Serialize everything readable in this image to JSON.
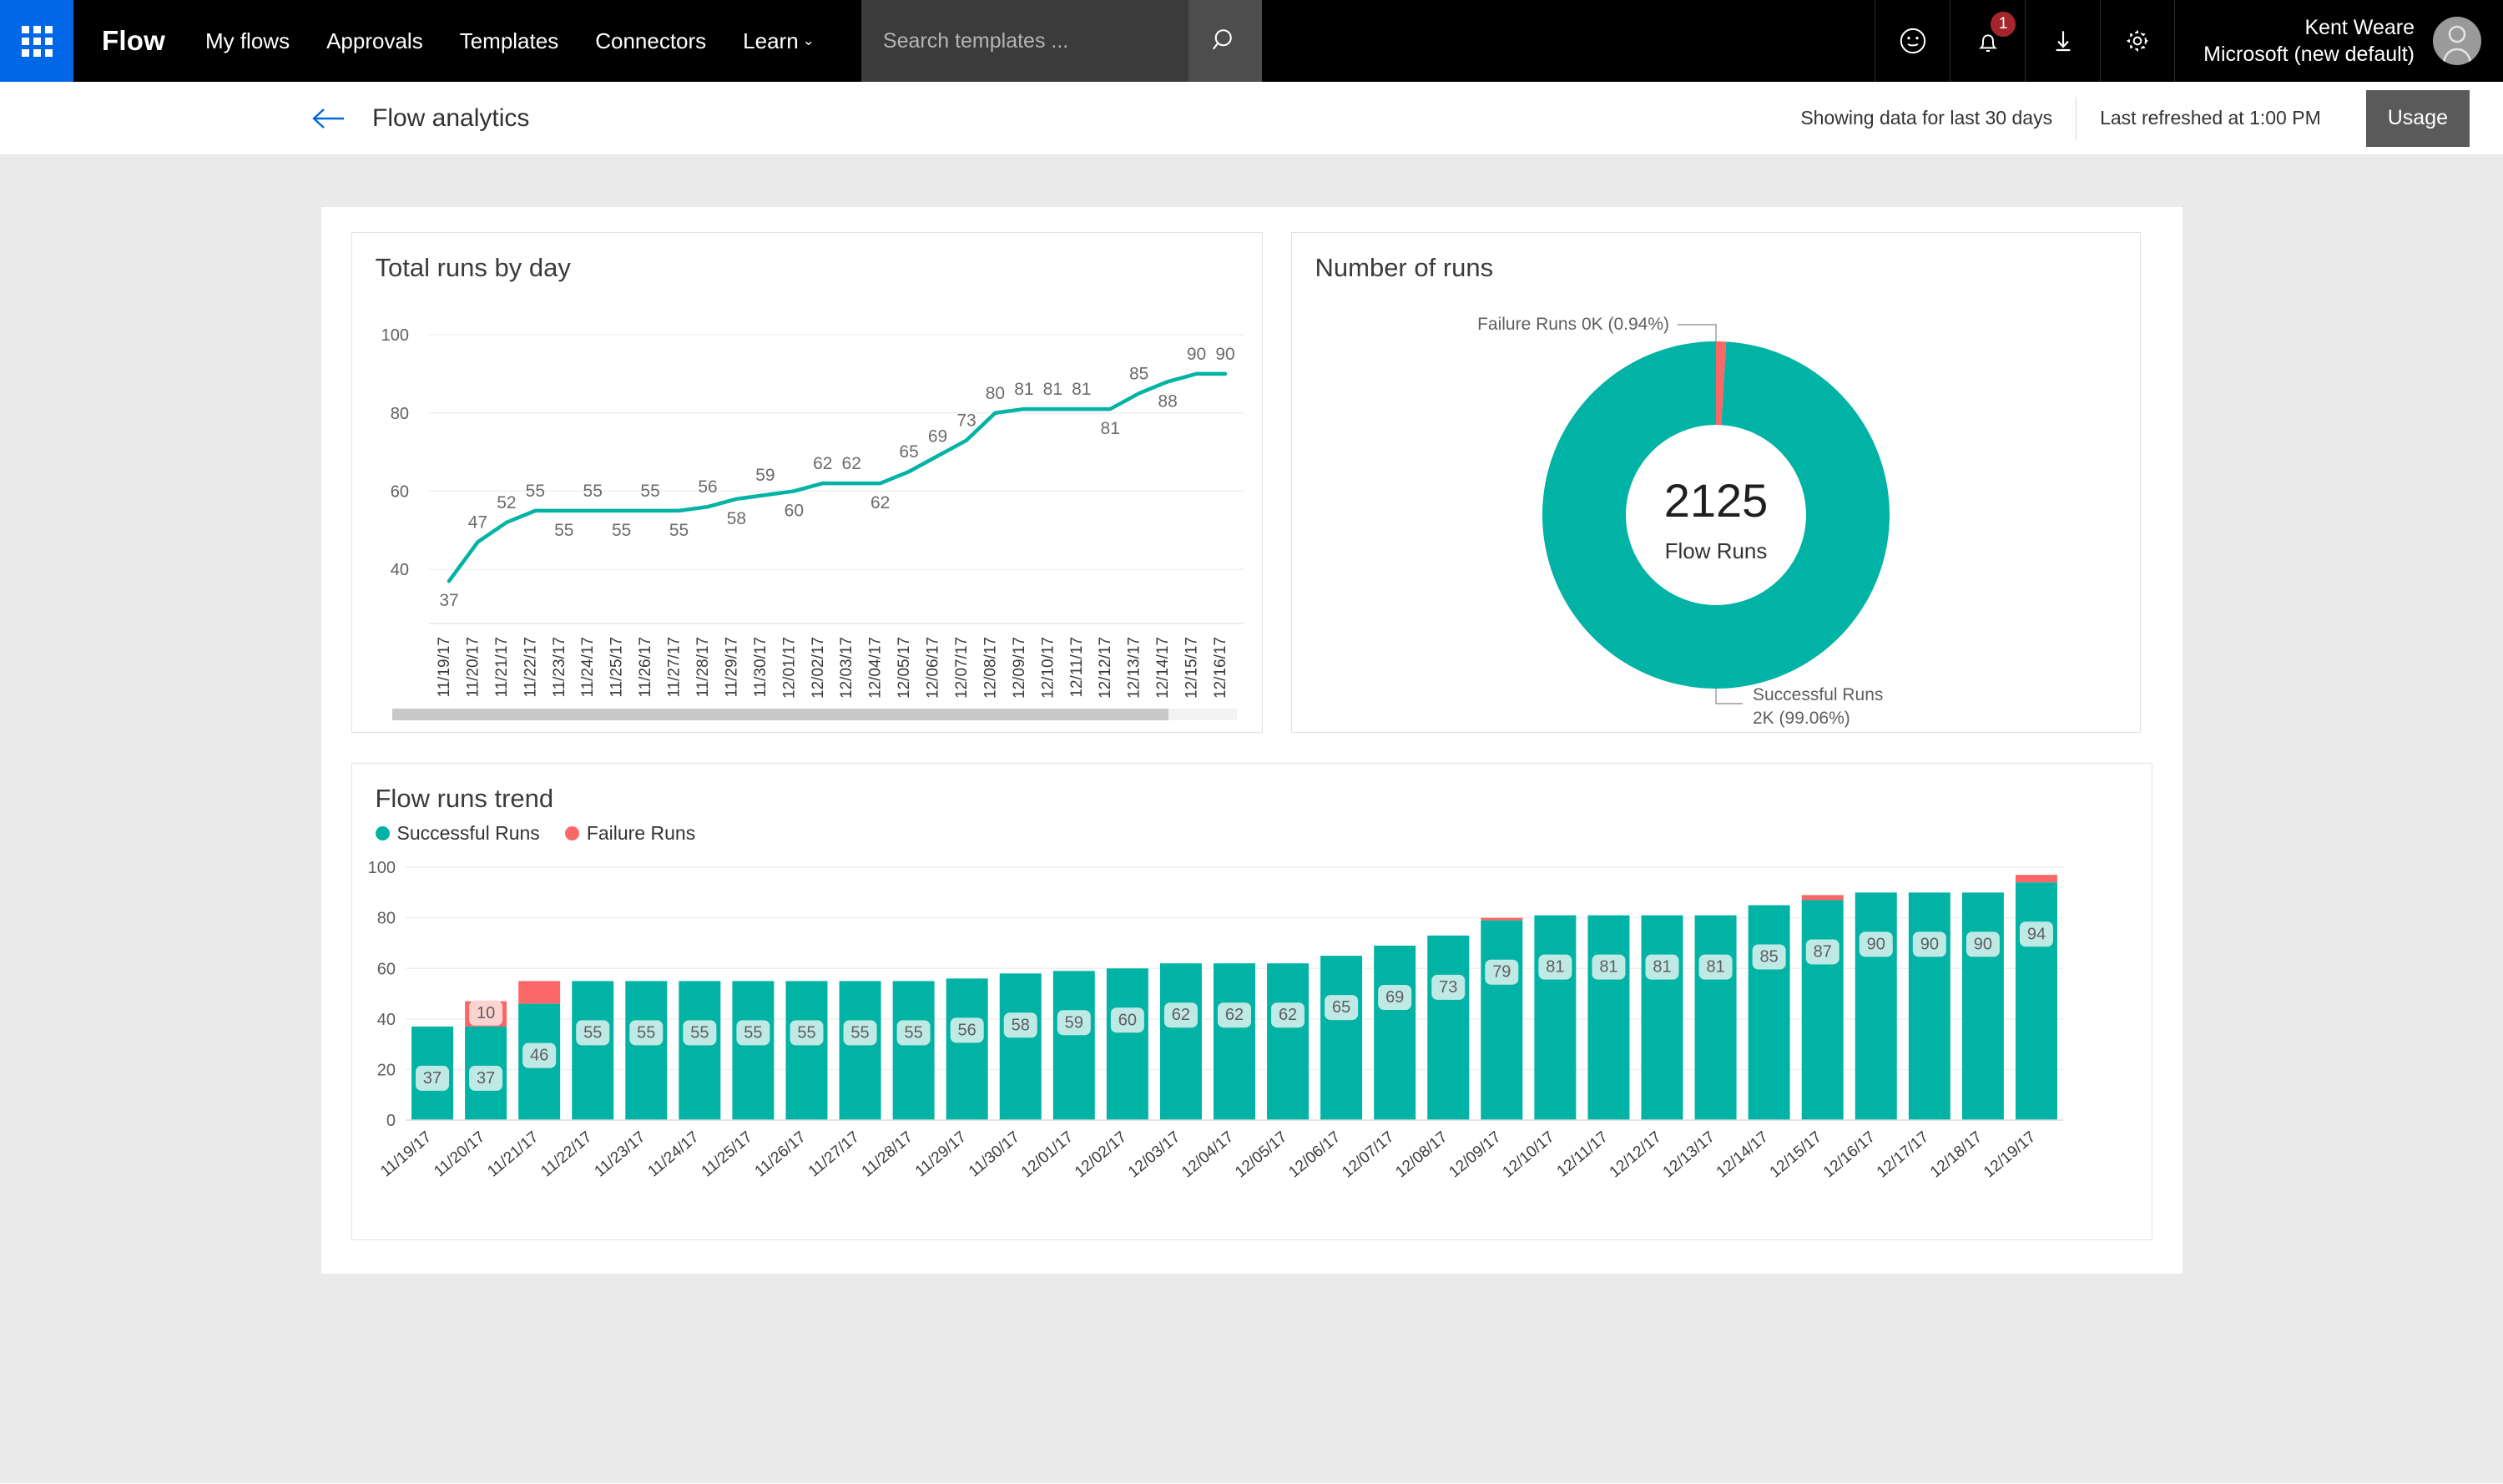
{
  "topnav": {
    "waffle_icon": "waffle-grid-icon",
    "brand": "Flow",
    "links": [
      {
        "label": "My flows",
        "caret": ""
      },
      {
        "label": "Approvals",
        "caret": ""
      },
      {
        "label": "Templates",
        "caret": ""
      },
      {
        "label": "Connectors",
        "caret": ""
      },
      {
        "label": "Learn",
        "caret": "⌄"
      }
    ],
    "search": {
      "value": "",
      "placeholder": "Search templates ...",
      "icon": "search-icon"
    },
    "icons": [
      {
        "name": "smiley-feedback-icon"
      },
      {
        "name": "notification-bell-icon",
        "badge": "1"
      },
      {
        "name": "download-icon"
      },
      {
        "name": "gear-settings-icon"
      }
    ],
    "user": {
      "name": "Kent Weare",
      "tenant": "Microsoft (new default)",
      "avatar": "person-avatar-icon"
    }
  },
  "subheader": {
    "back_icon": "back-arrow-icon",
    "title": "Flow analytics",
    "range_text": "Showing data for last 30 days",
    "refresh_text": "Last refreshed at 1:00 PM",
    "usage_button": "Usage"
  },
  "colors": {
    "teal": "#00b3a4",
    "teal_dark": "#0aa89c",
    "red": "#fa6767",
    "label_bg": "#bfe9e5",
    "red_label_bg": "#fbd4d0",
    "accent_blue": "#0067e6",
    "badge_red": "#a4262c"
  },
  "chart_data": [
    {
      "type": "line",
      "title": "Total runs by day",
      "xlabel": "",
      "ylabel": "",
      "ylim": [
        30,
        100
      ],
      "yticks": [
        40,
        60,
        80,
        100
      ],
      "grid": true,
      "legend": "none",
      "series": [
        {
          "name": "Total runs",
          "color": "#00b3a4",
          "values": [
            37,
            47,
            52,
            55,
            55,
            55,
            55,
            55,
            55,
            56,
            58,
            59,
            60,
            62,
            62,
            62,
            65,
            69,
            73,
            80,
            81,
            81,
            81,
            81,
            85,
            88,
            90,
            90
          ]
        }
      ],
      "categories": [
        "11/19/17",
        "11/20/17",
        "11/21/17",
        "11/22/17",
        "11/23/17",
        "11/24/17",
        "11/25/17",
        "11/26/17",
        "11/27/17",
        "11/28/17",
        "11/29/17",
        "11/30/17",
        "12/01/17",
        "12/02/17",
        "12/03/17",
        "12/04/17",
        "12/05/17",
        "12/06/17",
        "12/07/17",
        "12/08/17",
        "12/09/17",
        "12/10/17",
        "12/11/17",
        "12/12/17",
        "12/13/17",
        "12/14/17",
        "12/15/17",
        "12/16/17"
      ],
      "label_positions": [
        "below",
        "above",
        "above",
        "above",
        "below",
        "above",
        "below",
        "above",
        "below",
        "above",
        "below",
        "above",
        "below",
        "above",
        "above",
        "below",
        "above",
        "above",
        "above",
        "above",
        "above",
        "above",
        "above",
        "below",
        "above",
        "below",
        "above",
        "above"
      ],
      "scrollbar": {
        "visible": true,
        "thumb_fraction": 0.92
      }
    },
    {
      "type": "pie",
      "subtype": "donut",
      "title": "Number of runs",
      "center_value": "2125",
      "center_label": "Flow Runs",
      "slices": [
        {
          "name": "Successful Runs",
          "value": 2105,
          "percent": 99.06,
          "display": "Successful Runs\n2K (99.06%)",
          "label_line1": "Successful Runs",
          "label_line2": "2K (99.06%)",
          "color": "#00b3a4"
        },
        {
          "name": "Failure Runs",
          "value": 20,
          "percent": 0.94,
          "display": "Failure Runs 0K (0.94%)",
          "label_line1": "Failure Runs 0K (0.94%)",
          "label_line2": "",
          "color": "#fa6767"
        }
      ]
    },
    {
      "type": "bar",
      "subtype": "stacked",
      "title": "Flow runs trend",
      "xlabel": "",
      "ylabel": "",
      "ylim": [
        0,
        100
      ],
      "yticks": [
        0,
        20,
        40,
        60,
        80,
        100
      ],
      "grid": true,
      "legend_position": "top-left",
      "categories": [
        "11/19/17",
        "11/20/17",
        "11/21/17",
        "11/22/17",
        "11/23/17",
        "11/24/17",
        "11/25/17",
        "11/26/17",
        "11/27/17",
        "11/28/17",
        "11/29/17",
        "11/30/17",
        "12/01/17",
        "12/02/17",
        "12/03/17",
        "12/04/17",
        "12/05/17",
        "12/06/17",
        "12/07/17",
        "12/08/17",
        "12/09/17",
        "12/10/17",
        "12/11/17",
        "12/12/17",
        "12/13/17",
        "12/14/17",
        "12/15/17",
        "12/16/17",
        "12/17/17",
        "12/18/17",
        "12/19/17"
      ],
      "series": [
        {
          "name": "Successful Runs",
          "color": "#00b3a4",
          "values": [
            37,
            37,
            46,
            55,
            55,
            55,
            55,
            55,
            55,
            55,
            56,
            58,
            59,
            60,
            62,
            62,
            62,
            65,
            69,
            73,
            79,
            81,
            81,
            81,
            81,
            85,
            87,
            90,
            90,
            90,
            94
          ]
        },
        {
          "name": "Failure Runs",
          "color": "#fa6767",
          "values": [
            0,
            10,
            9,
            0,
            0,
            0,
            0,
            0,
            0,
            0,
            0,
            0,
            0,
            0,
            0,
            0,
            0,
            0,
            0,
            0,
            1,
            0,
            0,
            0,
            0,
            0,
            2,
            0,
            0,
            0,
            3
          ]
        }
      ],
      "visible_labels_success": [
        "37",
        "37",
        "46",
        "55",
        "55",
        "55",
        "55",
        "55",
        "55",
        "55",
        "56",
        "58",
        "59",
        "60",
        "62",
        "62",
        "62",
        "65",
        "69",
        "73",
        "79",
        "81",
        "81",
        "81",
        "81",
        "85",
        "87",
        "90",
        "90",
        "90",
        "94"
      ],
      "visible_labels_failure": [
        "",
        "10",
        "",
        "",
        "",
        "",
        "",
        "",
        "",
        "",
        "",
        "",
        "",
        "",
        "",
        "",
        "",
        "",
        "",
        "",
        "",
        "",
        "",
        "",
        "",
        "",
        "",
        "",
        "",
        "",
        ""
      ]
    }
  ]
}
